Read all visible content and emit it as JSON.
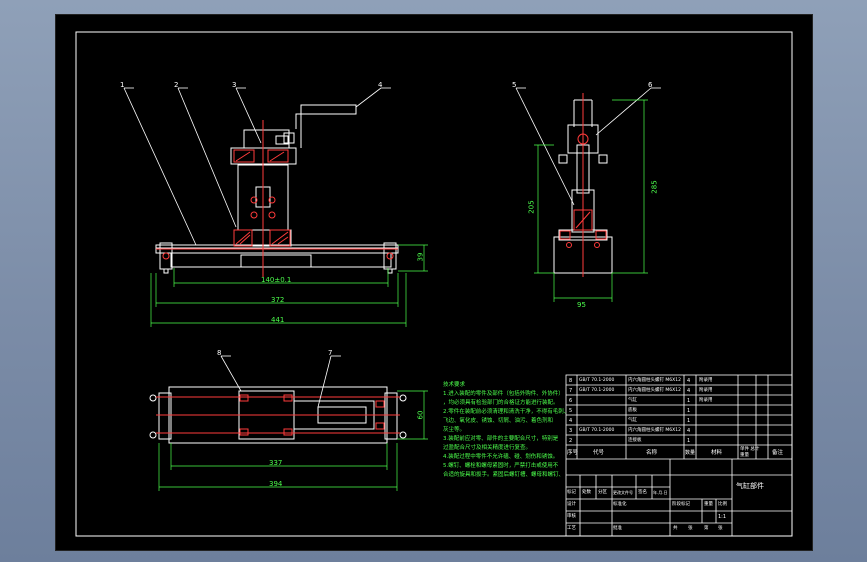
{
  "view": {
    "background_color": "#000000",
    "line_color": "#ffffff",
    "dimension_color": "#4cff4c",
    "centerline_color": "#ff3b3b",
    "section_color": "#ff3b3b",
    "balloon_color": "#ffff55"
  },
  "callouts": [
    "1",
    "2",
    "3",
    "4",
    "5",
    "6",
    "8",
    "7"
  ],
  "dimensions": {
    "front_stroke": "140±0.1",
    "front_inner": "372",
    "front_overall": "441",
    "front_height": "39",
    "side_width": "95",
    "side_left_height": "205",
    "side_right_height": "285",
    "top_inner": "337",
    "top_overall": "394",
    "top_height": "60"
  },
  "tech_notes": {
    "title": "技术要求",
    "lines": [
      "1.进入装配的零件及部件（包括外购件、外协件）",
      "，均必须具有检验部门的合格证方能进行装配。",
      "2.零件在装配前必须清理和清洗干净，不得有毛刺、",
      "飞边、氧化皮、锈蚀、切屑、油污、着色剂和",
      "灰尘等。",
      "3.装配前应对零、部件的主要配合尺寸，特别是",
      "过盈配合尺寸及相关精度进行复查。",
      "4.装配过程中零件不允许磕、碰、划伤和锈蚀。",
      "5.螺钉、螺栓和螺母紧固时，严禁打击或使用不",
      "合适的旋具和扳手。紧固后螺钉槽、螺母和螺钉、"
    ]
  },
  "bom": {
    "rows": [
      {
        "no": "8",
        "code": "GB/T 70.1-2000",
        "name": "内六角圆柱头螺钉 M6X12",
        "qty": "4",
        "material": "",
        "note": "附录用"
      },
      {
        "no": "7",
        "code": "GB/T 70.1-2000",
        "name": "内六角圆柱头螺钉 M6X12",
        "qty": "4",
        "material": "",
        "note": "附录用"
      },
      {
        "no": "6",
        "code": "",
        "name": "气缸",
        "qty": "1",
        "material": "",
        "note": "附录用"
      },
      {
        "no": "5",
        "code": "",
        "name": "底板",
        "qty": "1",
        "material": "",
        "note": ""
      },
      {
        "no": "4",
        "code": "",
        "name": "气缸",
        "qty": "1",
        "material": "",
        "note": ""
      },
      {
        "no": "3",
        "code": "GB/T 70.1-2000",
        "name": "内六角圆柱头螺钉 M6X12",
        "qty": "4",
        "material": "",
        "note": ""
      },
      {
        "no": "2",
        "code": "",
        "name": "连接板",
        "qty": "1",
        "material": "",
        "note": ""
      },
      {
        "no": "1",
        "code": "",
        "name": "",
        "qty": "",
        "material": "",
        "note": ""
      }
    ],
    "header": {
      "no": "序号",
      "code": "代号",
      "name": "名称",
      "qty": "数量",
      "material": "材料",
      "unit_total": "单件 总计",
      "weight": "重量",
      "note": "备注"
    }
  },
  "title_block": {
    "drawing_name": "气缸部件",
    "labels": [
      "标记",
      "处数",
      "分区",
      "更改文件号",
      "签名",
      "年.月.日",
      "设计",
      "标准化",
      "阶段标记",
      "重量",
      "比例",
      "审核",
      "工艺",
      "批准",
      "共",
      "张",
      "第",
      "张"
    ],
    "scale": "1:1"
  }
}
